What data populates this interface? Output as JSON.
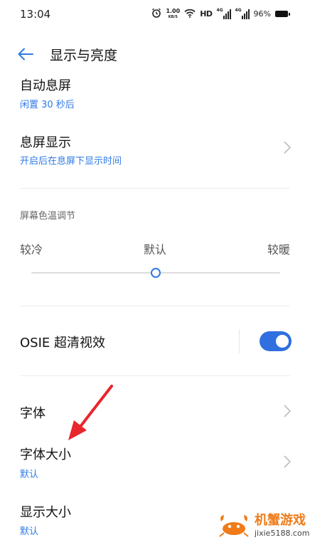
{
  "status_bar": {
    "time": "13:04",
    "speed_value": "1.00",
    "speed_unit": "KB/S",
    "hd_label": "HD",
    "signal_1_label": "4G",
    "signal_2_label": "4G",
    "battery_percent": "96%",
    "icons": [
      "alarm-icon",
      "wifi-icon",
      "signal-icon",
      "battery-icon"
    ]
  },
  "header": {
    "back_icon": "back-arrow-icon",
    "title": "显示与亮度"
  },
  "rows": [
    {
      "title": "自动息屏",
      "subtitle": "闲置 30 秒后"
    },
    {
      "title": "息屏显示",
      "subtitle": "开启后在息屏下显示时间"
    }
  ],
  "color_temp": {
    "section_label": "屏幕色温调节",
    "cool_label": "较冷",
    "default_label": "默认",
    "warm_label": "较暖",
    "slider_value": 0.5
  },
  "osie": {
    "title": "OSIE 超清视效",
    "enabled": true
  },
  "font_rows": [
    {
      "title": "字体",
      "subtitle": ""
    },
    {
      "title": "字体大小",
      "subtitle": "默认"
    },
    {
      "title": "显示大小",
      "subtitle": "默认"
    }
  ],
  "watermark": {
    "brand": "机蟹游戏",
    "url": "jixie5188.com"
  },
  "colors": {
    "accent": "#2f7ae5",
    "toggle": "#2f6fe0",
    "annotation_arrow": "#e8262c",
    "watermark_orange": "#f07b18"
  }
}
